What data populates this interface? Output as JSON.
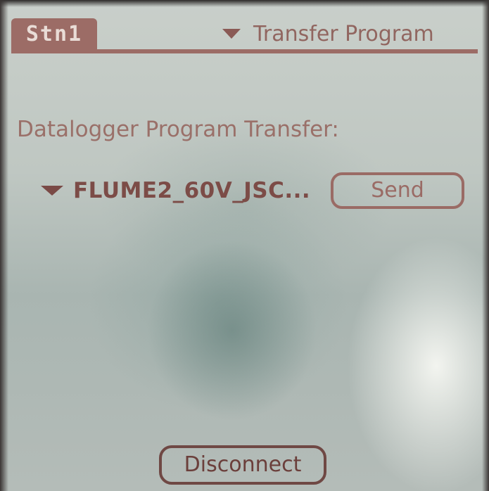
{
  "header": {
    "app_title": "Stn1",
    "menu_label": "Transfer Program"
  },
  "main": {
    "section_label": "Datalogger Program Transfer:",
    "program_select": {
      "selected": "FLUME2_60V_JSC..."
    },
    "send_label": "Send"
  },
  "footer": {
    "disconnect_label": "Disconnect"
  },
  "icons": {
    "menu_dropdown": "dropdown-triangle-icon",
    "program_dropdown": "dropdown-triangle-icon"
  },
  "colors": {
    "ink": "#8a5a55",
    "title_tab": "#9c6c66",
    "screen_bg": "#bfc7c2"
  }
}
